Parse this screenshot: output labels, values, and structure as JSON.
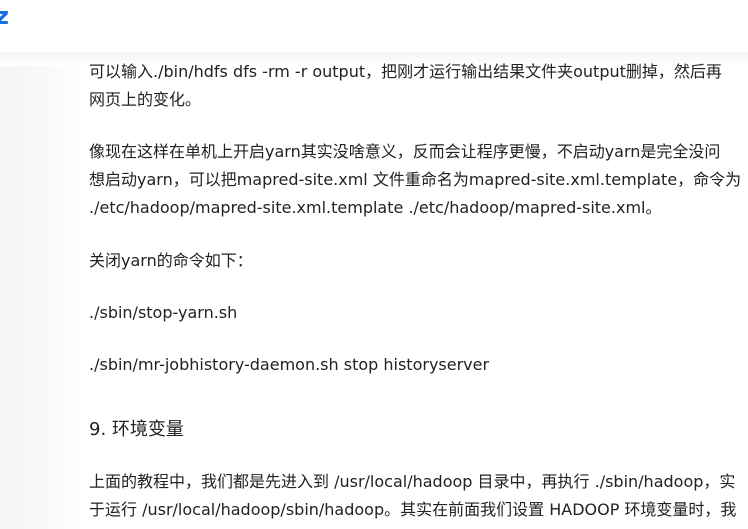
{
  "header": {
    "logo_fragment": "z"
  },
  "article": {
    "p1": [
      "可以输入./bin/hdfs dfs -rm -r output，把刚才运行输出结果文件夹output删掉，然后再",
      "网页上的变化。"
    ],
    "p2": [
      "像现在这样在单机上开启yarn其实没啥意义，反而会让程序更慢，不启动yarn是完全没问",
      "想启动yarn，可以把mapred-site.xml 文件重命名为mapred-site.xml.template，命令为",
      "./etc/hadoop/mapred-site.xml.template ./etc/hadoop/mapred-site.xml。"
    ],
    "p3": "关闭yarn的命令如下：",
    "p4": "./sbin/stop-yarn.sh",
    "p5": "./sbin/mr-jobhistory-daemon.sh stop historyserver",
    "heading": "9. 环境变量",
    "p6": [
      "上面的教程中，我们都是先进入到 /usr/local/hadoop 目录中，再执行 ./sbin/hadoop，实",
      "于运行 /usr/local/hadoop/sbin/hadoop。其实在前面我们设置 HADOOP 环境变量时，我"
    ]
  }
}
